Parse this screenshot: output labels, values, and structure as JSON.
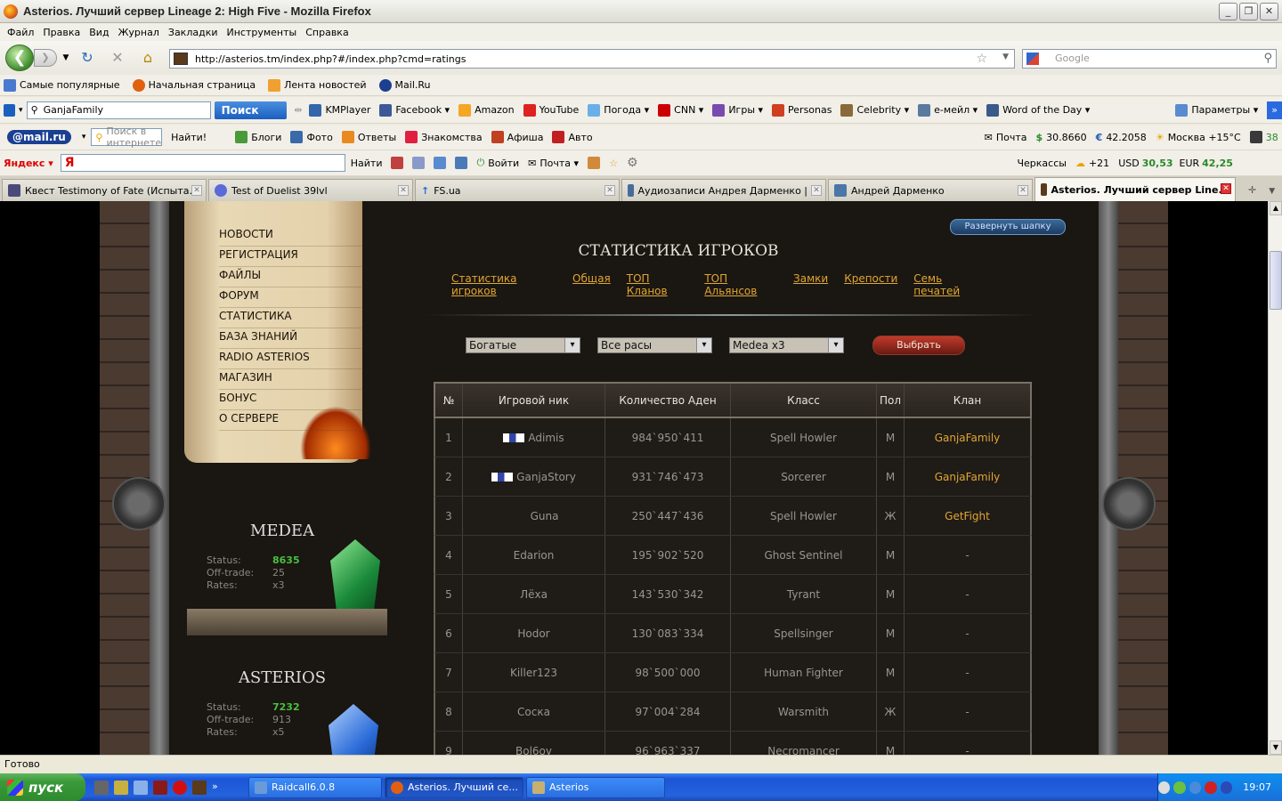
{
  "window": {
    "title": "Asterios. Лучший сервер Lineage 2: High Five - Mozilla Firefox"
  },
  "menu": [
    "Файл",
    "Правка",
    "Вид",
    "Журнал",
    "Закладки",
    "Инструменты",
    "Справка"
  ],
  "nav": {
    "url": "http://asterios.tm/index.php?#/index.php?cmd=ratings",
    "search_placeholder": "Google"
  },
  "bookmarks": [
    "Самые популярные",
    "Начальная страница",
    "Лента новостей",
    "Mail.Ru"
  ],
  "toolbar1": {
    "search_value": "GanjaFamily",
    "search_btn": "Поиск",
    "items": [
      "KMPlayer",
      "Facebook ▾",
      "Amazon",
      "YouTube",
      "Погода ▾",
      "CNN ▾",
      "Игры ▾",
      "Personas",
      "Celebrity ▾",
      "е-мейл ▾",
      "Word of the Day ▾"
    ],
    "params": "Параметры ▾"
  },
  "toolbar2": {
    "mailru": "@mail.ru",
    "search_placeholder": "Поиск в интернете",
    "find": "Найти!",
    "items": [
      "Блоги",
      "Фото",
      "Ответы",
      "Знакомства",
      "Афиша",
      "Авто"
    ],
    "mail": "Почта",
    "usd": "30.8660",
    "eur": "42.2058",
    "weather": "Москва +15°C",
    "count": "38"
  },
  "toolbar3": {
    "yandex": "Яндекс ▾",
    "ya": "Я",
    "find": "Найти",
    "login": "Войти",
    "mail": "Почта ▾",
    "city": "Черкассы",
    "temp": "+21",
    "usd_label": "USD",
    "usd": "30,53",
    "eur_label": "EUR",
    "eur": "42,25"
  },
  "tabs": [
    {
      "label": "Квест Testimony of Fate (Испыта..."
    },
    {
      "label": "Test of Duelist 39lvl"
    },
    {
      "label": "FS.ua"
    },
    {
      "label": "Аудиозаписи Андрея Дарменко | ..."
    },
    {
      "label": "Андрей Дарменко"
    },
    {
      "label": "Asterios. Лучший сервер Line..."
    }
  ],
  "site": {
    "menu": [
      "НОВОСТИ",
      "РЕГИСТРАЦИЯ",
      "ФАЙЛЫ",
      "ФОРУМ",
      "СТАТИСТИКА",
      "БАЗА ЗНАНИЙ",
      "RADIO ASTERIOS",
      "МАГАЗИН",
      "БОНУС",
      "О СЕРВЕРЕ"
    ],
    "expand": "Развернуть шапку",
    "title": "СТАТИСТИКА ИГРОКОВ",
    "sublinks": [
      "Статистика игроков",
      "Общая",
      "ТОП Кланов",
      "ТОП Альянсов",
      "Замки",
      "Крепости",
      "Семь печатей"
    ],
    "filters": {
      "type": "Богатые",
      "race": "Все расы",
      "server": "Medea x3",
      "go": "Выбрать"
    },
    "servers": [
      {
        "name": "MEDEA",
        "status_label": "Status:",
        "status": "8635",
        "offtrade_label": "Off-trade:",
        "offtrade": "25",
        "rates_label": "Rates:",
        "rates": "x3"
      },
      {
        "name": "ASTERIOS",
        "status_label": "Status:",
        "status": "7232",
        "offtrade_label": "Off-trade:",
        "offtrade": "913",
        "rates_label": "Rates:",
        "rates": "x5"
      }
    ],
    "table": {
      "headers": [
        "№",
        "Игровой ник",
        "Количество Аден",
        "Класс",
        "Пол",
        "Клан"
      ],
      "rows": [
        [
          "1",
          "Adimis",
          "984`950`411",
          "Spell Howler",
          "М",
          "GanjaFamily"
        ],
        [
          "2",
          "GanjaStory",
          "931`746`473",
          "Sorcerer",
          "М",
          "GanjaFamily"
        ],
        [
          "3",
          "Guna",
          "250`447`436",
          "Spell Howler",
          "Ж",
          "GetFight"
        ],
        [
          "4",
          "Edarion",
          "195`902`520",
          "Ghost Sentinel",
          "М",
          "-"
        ],
        [
          "5",
          "Лёха",
          "143`530`342",
          "Tyrant",
          "М",
          "-"
        ],
        [
          "6",
          "Hodor",
          "130`083`334",
          "Spellsinger",
          "М",
          "-"
        ],
        [
          "7",
          "Killer123",
          "98`500`000",
          "Human Fighter",
          "М",
          "-"
        ],
        [
          "8",
          "Сocка",
          "97`004`284",
          "Warsmith",
          "Ж",
          "-"
        ],
        [
          "9",
          "Bol6oy",
          "96`963`337",
          "Necromancer",
          "М",
          "-"
        ]
      ]
    }
  },
  "status": "Готово",
  "taskbar": {
    "start": "пуск",
    "tasks": [
      "Raidcall6.0.8",
      "Asterios. Лучший се...",
      "Asterios"
    ],
    "clock": "19:07"
  }
}
